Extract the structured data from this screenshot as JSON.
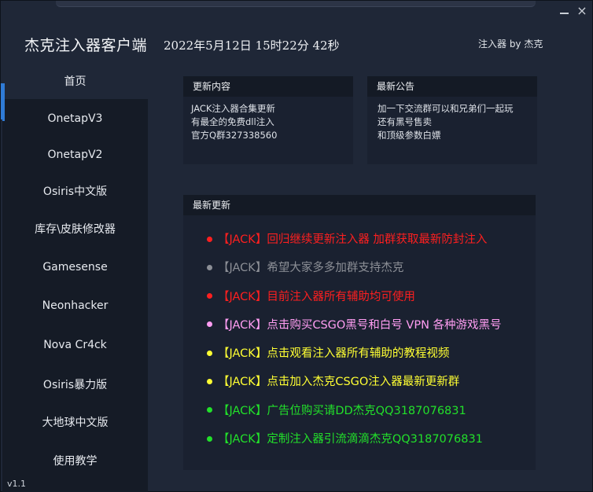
{
  "window": {
    "title": "杰克注入器客户端",
    "datetime": "2022年5月12日 15时22分 42秒",
    "author": "注入器 by 杰克",
    "close_glyph": "×"
  },
  "sidebar": {
    "items": [
      {
        "label": "首页"
      },
      {
        "label": "OnetapV3"
      },
      {
        "label": "OnetapV2"
      },
      {
        "label": "Osiris中文版"
      },
      {
        "label": "库存\\皮肤修改器"
      },
      {
        "label": "Gamesense"
      },
      {
        "label": "Neonhacker"
      },
      {
        "label": "Nova Cr4ck"
      },
      {
        "label": "Osiris暴力版"
      },
      {
        "label": "大地球中文版"
      },
      {
        "label": "使用教学"
      }
    ],
    "active_index": 0,
    "version": "v1.1"
  },
  "update_content": {
    "title": "更新内容",
    "lines": [
      "JACK注入器合集更新",
      "有最全的免费dll注入",
      "官方Q群327338560"
    ]
  },
  "announcement": {
    "title": "最新公告",
    "lines": [
      "加一下交流群可以和兄弟们一起玩",
      "还有黑号售卖",
      "和顶级参数白嫖"
    ]
  },
  "latest": {
    "title": "最新更新",
    "items": [
      {
        "text": "【JACK】回归继续更新注入器 加群获取最新防封注入",
        "color": "#ff1f1f"
      },
      {
        "text": "【JACK】希望大家多多加群支持杰克",
        "color": "#8c8f96"
      },
      {
        "text": "【JACK】目前注入器所有辅助均可使用",
        "color": "#ff1f1f"
      },
      {
        "text": "【JACK】点击购买CSGO黑号和白号 VPN 各种游戏黑号",
        "color": "#ff9df2"
      },
      {
        "text": "【JACK】点击观看注入器所有辅助的教程视频",
        "color": "#ffff33"
      },
      {
        "text": "【JACK】点击加入杰克CSGO注入器最新更新群",
        "color": "#ffff33"
      },
      {
        "text": "【JACK】广告位购买请DD杰克QQ3187076831",
        "color": "#22e02a"
      },
      {
        "text": "【JACK】定制注入器引流滴滴杰克QQ3187076831",
        "color": "#22e02a"
      }
    ]
  },
  "colors": {
    "accent": "#2f7bd6",
    "sidebar_bg": "#151b26",
    "panel_header_bg": "#141a25"
  }
}
